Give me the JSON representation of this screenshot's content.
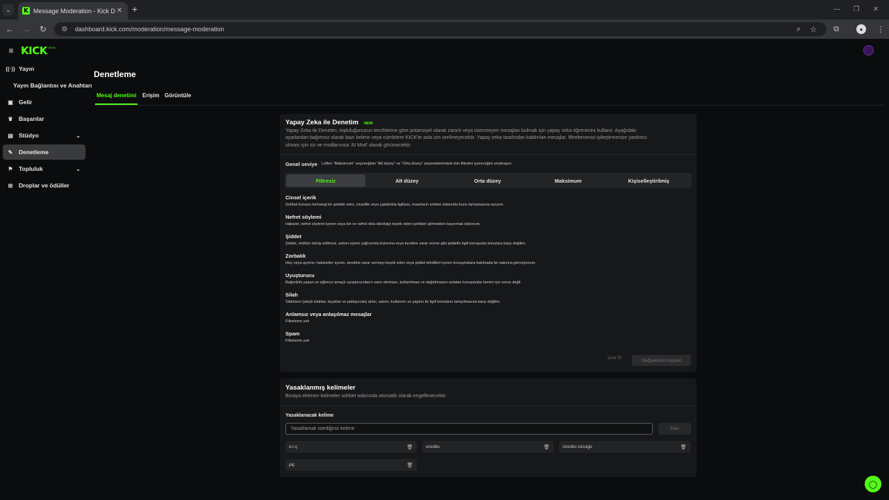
{
  "browser": {
    "tab_title": "Message Moderation - Kick Da",
    "tab_favicon": "K",
    "url": "dashboard.kick.com/moderation/message-moderation"
  },
  "header": {
    "logo": "KICK",
    "logo_sup": "BETA"
  },
  "sidebar": {
    "items": [
      {
        "label": "Yayın",
        "icon": "broadcast-icon"
      },
      {
        "label": "Yayın Bağlantısı ve Anahtarı"
      },
      {
        "label": "Gelir",
        "icon": "wallet-icon"
      },
      {
        "label": "Başarılar",
        "icon": "trophy-icon"
      },
      {
        "label": "Stüdyo",
        "icon": "studio-icon"
      },
      {
        "label": "Denetleme",
        "icon": "wrench-icon"
      },
      {
        "label": "Topluluk",
        "icon": "community-icon"
      },
      {
        "label": "Droplar ve ödüller",
        "icon": "gift-icon"
      }
    ]
  },
  "page": {
    "title": "Denetleme",
    "tabs": [
      "Mesaj denetimi",
      "Erişim",
      "Görüntüle"
    ]
  },
  "ai_card": {
    "title": "Yapay Zeka ile Denetim",
    "badge": "NEW",
    "desc1": "Yapay Zeka ile Denetim, topluluğunuzun tercihlerine göre potansiyel olarak zararlı veya istenmeyen mesajları bulmak için yapay zeka öğrenimini kullanır. Aşağıdaki",
    "desc2": "ayarlardan bağımsız olarak bazı kelime veya cümlelere KICK'te asla izin verilmeyecektir. Yapay zeka tarafından kaldırılan mesajlar, filtrelemenizi iyileştirmenize yardımcı",
    "desc3": "olması için siz ve modlarınıza 'AI Mod' olarak görünecektir.",
    "level_label": "Genel seviye",
    "level_hint": "Lütfen \"Maksimum\" seçeneğinin \"Alt düzey\" ve \"Orta düzey\" seçeneklerindeki tüm filtreleri içereceğini unutmayın",
    "levels": [
      "Filtresiz",
      "Alt düzey",
      "Orta düzey",
      "Maksimum",
      "Kişiselleştirilmiş"
    ],
    "categories": [
      {
        "title": "Cinsel içerik",
        "desc": "Sohbet konusu herhangi bir şekilde seks, cinsellik veya çıplaklıkla ilgiliyse, insanların sohbet odasında bunu tartışmasına razıyım."
      },
      {
        "title": "Nefret söylemi",
        "desc": "Hakaret, nefret söylemi içeren veya kin ve nefret dolu ideolojiyi teşvik eden içerikleri görmekten kaçınmak istiyorum."
      },
      {
        "title": "Şiddet",
        "desc": "Şiddet, mülkün tahrip edilmesi, askeri eylem çağrısında bulunma veya kendine zarar verme gibi şiddetle ilgili konuşulan konulara karşı değilim."
      },
      {
        "title": "Zorbalık",
        "desc": "Irkçı veya ayrımcı hakaretler içeren, kendine zarar vermeyi teşvik eden veya şiddet tehditleri içeren konuşmalara katılmada bir sakınca görmüyorum."
      },
      {
        "title": "Uyuşturucu",
        "desc": "Bağımlılık yapan ve eğlence amaçlı uyuşturucuların satın alınması, kullanılması ve dağıtılmasını anlatan konuşmalar benim için sorun değil."
      },
      {
        "title": "Silah",
        "desc": "Silahların (ateşli silahlar, bıçaklar ve patlayıcılar) alımı, satımı, kullanımı ve yapımı ile ilgili konuların tartışılmasına karşı değilim."
      },
      {
        "title": "Anlamsız veya anlaşılmaz mesajlar",
        "desc": "Filtreleme yok"
      },
      {
        "title": "Spam",
        "desc": "Filtreleme yok"
      }
    ],
    "cancel_label": "İptal Et",
    "save_label": "Değişiklikleri kaydet"
  },
  "banned_card": {
    "title": "Yasaklanmış kelimeler",
    "desc": "Buraya eklenen kelimeler sohbet odanızda otomatik olarak engellenecektir.",
    "field_label": "Yasaklanacak kelime",
    "input_placeholder": "Yasaklamak istediğiniz kelime",
    "add_label": "Ekle",
    "words": [
      "o.r.ç",
      "orusbu",
      "orusbu cocugu",
      "piç"
    ]
  },
  "colors": {
    "accent": "#53fc18",
    "bg": "#0b0c0d",
    "card": "#17181a"
  }
}
